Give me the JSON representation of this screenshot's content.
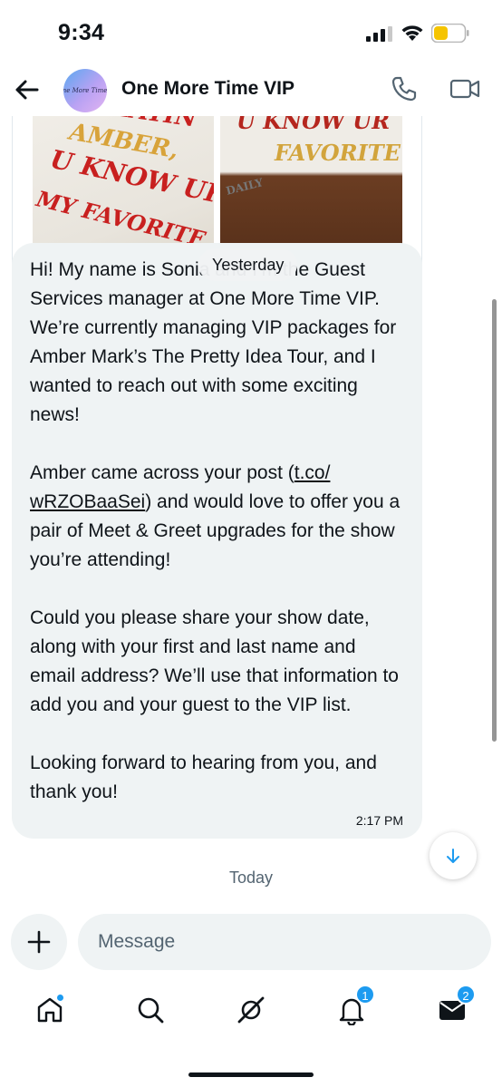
{
  "status_bar": {
    "time": "9:34"
  },
  "header": {
    "title": "One More Time VIP",
    "avatar_text": "One More Time..."
  },
  "photos": {
    "left_sign_lines": [
      "PLAYIN",
      "AMBER,",
      "U KNOW UR",
      "MY FAVORITE"
    ],
    "right_sign_lines": [
      "U KNOW UR",
      "FAVORITE",
      "DAILY"
    ]
  },
  "date_divider_top": "Yesterday",
  "message": {
    "paragraphs": [
      "Hi! My name is Sonia and I’m the Guest Services manager at One More Time VIP. We’re currently managing VIP packages for Amber Mark’s The Pretty Idea Tour, and I wanted to reach out with some exciting news!",
      "Could you please share your show date, along with your first and last name and email address? We’ll use that information to add you and your guest to the VIP list.",
      "Looking forward to hearing from you, and thank you!"
    ],
    "para2_before": "Amber came across your post (",
    "para2_link": "t.co/​wRZOBaaSei",
    "para2_after": ") and would love to offer you a pair of Meet & Greet upgrades for the show you’re attending!",
    "time": "2:17 PM"
  },
  "date_divider_bottom": "Today",
  "composer": {
    "placeholder": "Message"
  },
  "tabbar": {
    "notifications_badge": "1",
    "messages_badge": "2"
  }
}
